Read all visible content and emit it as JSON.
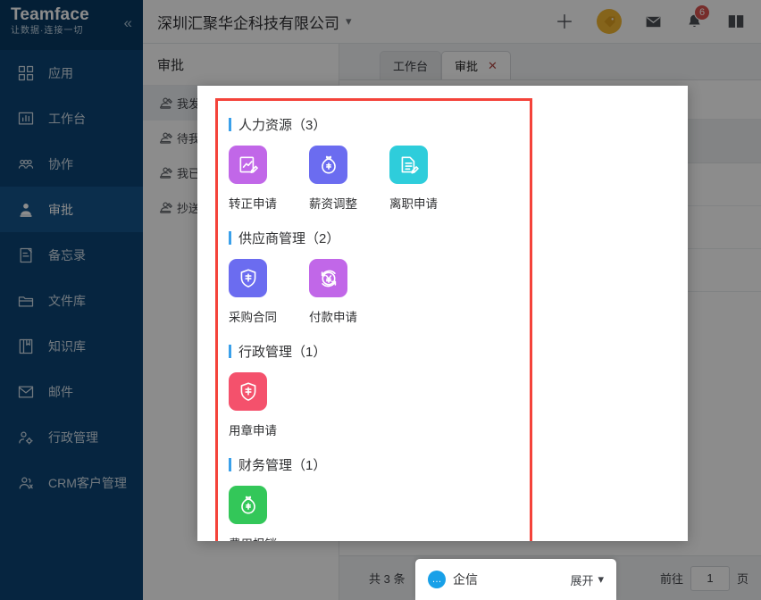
{
  "brand": {
    "name": "Teamface",
    "slogan": "让数据·连接一切",
    "collapse_icon": "double-chevron-left"
  },
  "sidebar": {
    "items": [
      {
        "label": "应用",
        "icon": "grid-apps-icon",
        "active": false
      },
      {
        "label": "工作台",
        "icon": "dashboard-icon",
        "active": false
      },
      {
        "label": "协作",
        "icon": "people-group-icon",
        "active": false
      },
      {
        "label": "审批",
        "icon": "user-stamp-icon",
        "active": true
      },
      {
        "label": "备忘录",
        "icon": "note-icon",
        "active": false
      },
      {
        "label": "文件库",
        "icon": "folder-icon",
        "active": false
      },
      {
        "label": "知识库",
        "icon": "book-icon",
        "active": false
      },
      {
        "label": "邮件",
        "icon": "envelope-icon",
        "active": false
      },
      {
        "label": "行政管理",
        "icon": "user-gear-icon",
        "active": false
      },
      {
        "label": "CRM客户管理",
        "icon": "user-crm-icon",
        "active": false
      }
    ]
  },
  "header": {
    "org_name": "深圳汇聚华企科技有限公司",
    "org_chevron": "chevron-down-icon",
    "icons": [
      {
        "name": "plus-icon",
        "badge": null
      },
      {
        "name": "tag-icon",
        "badge": null
      },
      {
        "name": "mail-icon",
        "badge": null
      },
      {
        "name": "bell-icon",
        "badge": "6"
      },
      {
        "name": "book-open-icon",
        "badge": null
      }
    ]
  },
  "subnav": {
    "title": "审批",
    "items": [
      {
        "label": "我发起的",
        "icon": "stamp-icon",
        "active": true
      },
      {
        "label": "待我审批",
        "icon": "stamp-icon",
        "active": false
      },
      {
        "label": "我已审批",
        "icon": "stamp-icon",
        "active": false
      },
      {
        "label": "抄送我的",
        "icon": "stamp-icon",
        "active": false
      }
    ]
  },
  "tabs": [
    {
      "label": "工作台",
      "active": false,
      "closable": false
    },
    {
      "label": "审批",
      "active": true,
      "closable": true,
      "close_icon": "close-icon"
    }
  ],
  "pager": {
    "total_text": "共 3 条",
    "goto_label": "前往",
    "page_value": "1",
    "page_unit": "页"
  },
  "im": {
    "icon": "chat-bubble-icon",
    "name": "企信",
    "expand_label": "展开",
    "expand_icon": "chevron-down-icon"
  },
  "panel": {
    "highlight_color": "#f4433a",
    "accent_color": "#3aa0ea",
    "groups": [
      {
        "title": "人力资源（3）",
        "apps": [
          {
            "name": "转正申请",
            "icon": "chart-edit-icon",
            "color": "#c167e8"
          },
          {
            "name": "薪资调整",
            "icon": "money-bag-icon",
            "color": "#6b6cf0"
          },
          {
            "name": "离职申请",
            "icon": "doc-edit-icon",
            "color": "#2ecddb"
          }
        ]
      },
      {
        "title": "供应商管理（2）",
        "apps": [
          {
            "name": "采购合同",
            "icon": "shield-bao-icon",
            "color": "#6b6cf0"
          },
          {
            "name": "付款申请",
            "icon": "yuan-refresh-icon",
            "color": "#c167e8"
          }
        ]
      },
      {
        "title": "行政管理（1）",
        "apps": [
          {
            "name": "用章申请",
            "icon": "shield-bao-icon",
            "color": "#f4516c"
          }
        ]
      },
      {
        "title": "财务管理（1）",
        "apps": [
          {
            "name": "费用报销",
            "icon": "money-bag-icon",
            "color": "#33c759"
          }
        ]
      }
    ]
  }
}
